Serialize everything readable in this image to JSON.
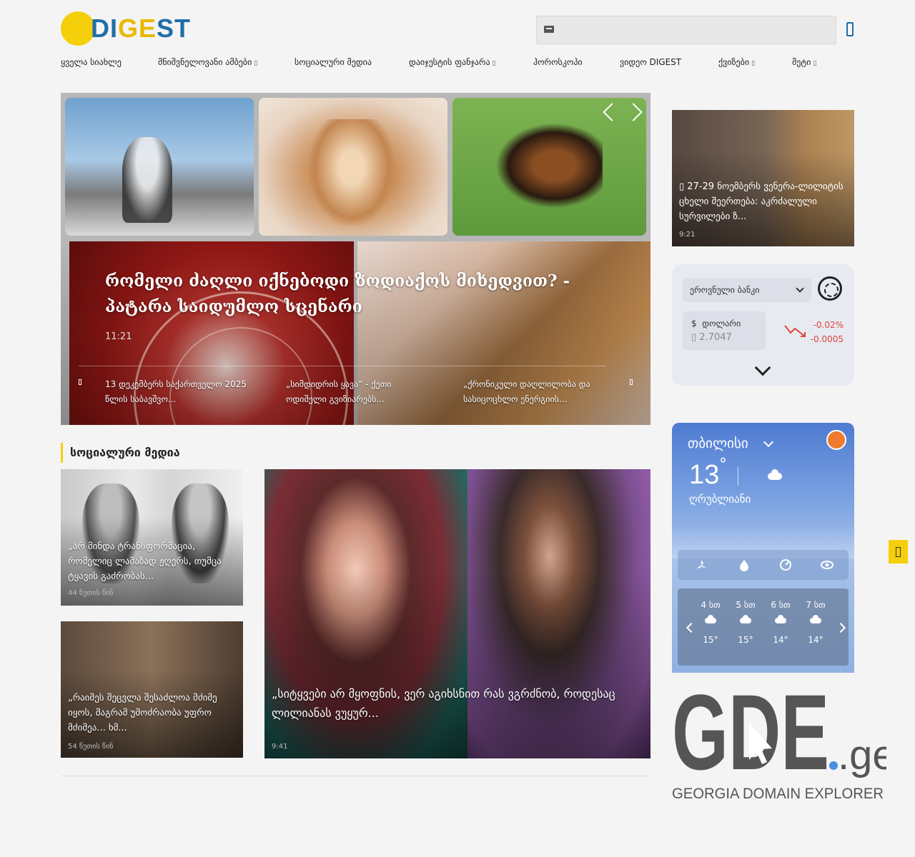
{
  "brand": {
    "logo_text_part1": "DI",
    "logo_text_part2": "GE",
    "logo_text_part3": "ST",
    "sun_color": "#f5cf0a",
    "blue_color": "#1f6fa8"
  },
  "search": {
    "placeholder": ""
  },
  "nav": {
    "items": [
      {
        "label": "ყველა სიახლე",
        "has_dropdown": false
      },
      {
        "label": "მნიშვნელოვანი ამბები",
        "has_dropdown": true
      },
      {
        "label": "სოციალური მედია",
        "has_dropdown": false
      },
      {
        "label": "დაიჯესტის ფანჯარა",
        "has_dropdown": true
      },
      {
        "label": "ჰოროსკოპი",
        "has_dropdown": false
      },
      {
        "label": "ვიდეო DIGEST",
        "has_dropdown": false
      },
      {
        "label": "ქვიზები",
        "has_dropdown": true
      },
      {
        "label": "მეტი",
        "has_dropdown": true
      }
    ],
    "dropdown_glyph": "▯"
  },
  "hero": {
    "title": "რომელი ძაღლი იქნებოდი ზოდიაქოს მიხედვით? - პატარა საიდუმლო სცენარი",
    "time": "11:21",
    "sub_items": [
      "13 დეკემბერს საქართველო 2025 წლის საბავშვო...",
      "„სიმდიდრის ყავა“ - ქეთი ოდიშელი გვიზიარებს...",
      "„ქრონიკული დაღლილობა და სასიცოცხლო ენერგიის..."
    ]
  },
  "social": {
    "heading": "სოციალური მედია",
    "cards": [
      {
        "title": "„არ მინდა ტრანსფორმაცია, რომელიც ლამაზად ჟღერს, თუმცა ტყავის გაძრობას...",
        "time": "44 წუთის წინ"
      },
      {
        "title": "„რაიმეს შეცვლა შესაძლოა მძიმე იყოს, მაგრამ უმოძრაობა უფრო მძიმეა... ხმ...",
        "time": "54 წუთის წინ"
      },
      {
        "title": "„სიტყვები არ მყოფნის, ვერ აგიხსნით რას ვგრძნობ, როდესაც ლილიანას ვუყურ...",
        "time": "9:41"
      }
    ]
  },
  "sidebar": {
    "news": {
      "title": "▯ 27-29 ნოემბერს ვენერა-ლილიტის ცხელი შეერთება: აკრძალული სურვილები ზ...",
      "time": "9:21"
    },
    "currency": {
      "bank": "ეროვნული ბანკი",
      "currency_symbol": "$",
      "currency_name": "დოლარი",
      "rate": "▯ 2.7047",
      "change_percent": "-0.02%",
      "change_value": "-0.0005",
      "trend": "down",
      "down_color": "#e0443c"
    },
    "weather": {
      "city": "თბილისი",
      "temperature": "13",
      "degree": "°",
      "condition": "ღრუბლიანი",
      "stat_icons": [
        "wind-icon",
        "humidity-icon",
        "pressure-icon",
        "visibility-icon"
      ],
      "hourly": [
        {
          "hour": "4 სთ",
          "temp": "15°"
        },
        {
          "hour": "5 სთ",
          "temp": "15°"
        },
        {
          "hour": "6 სთ",
          "temp": "14°"
        },
        {
          "hour": "7 სთ",
          "temp": "14°"
        }
      ]
    },
    "ad": {
      "logo_main": "GDE",
      "logo_tld": ".ge",
      "tagline": "GEORGIA DOMAIN EXPLORER"
    }
  }
}
